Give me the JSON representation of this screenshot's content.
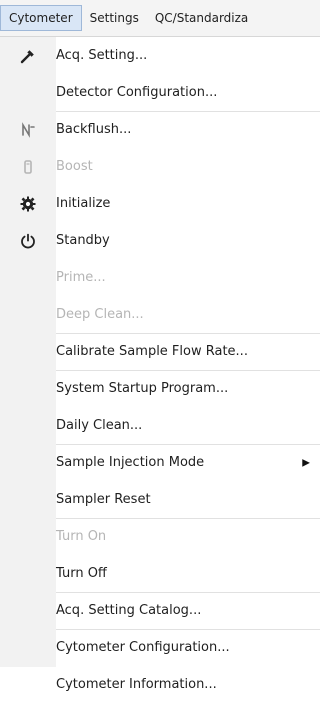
{
  "menubar": {
    "items": [
      {
        "label": "Cytometer"
      },
      {
        "label": "Settings"
      },
      {
        "label": "QC/Standardiza"
      }
    ]
  },
  "menu": {
    "items": [
      {
        "label": "Acq. Setting...",
        "icon": "wrench-icon",
        "disabled": false
      },
      {
        "label": "Detector Configuration...",
        "icon": "",
        "disabled": false
      },
      {
        "label": "Backflush...",
        "icon": "backflush-icon",
        "disabled": false
      },
      {
        "label": "Boost",
        "icon": "boost-icon",
        "disabled": true
      },
      {
        "label": "Initialize",
        "icon": "gear-icon",
        "disabled": false
      },
      {
        "label": "Standby",
        "icon": "power-icon",
        "disabled": false
      },
      {
        "label": "Prime...",
        "icon": "",
        "disabled": true
      },
      {
        "label": "Deep Clean...",
        "icon": "",
        "disabled": true
      },
      {
        "label": "Calibrate Sample Flow Rate...",
        "icon": "",
        "disabled": false
      },
      {
        "label": "System Startup Program...",
        "icon": "",
        "disabled": false
      },
      {
        "label": "Daily Clean...",
        "icon": "",
        "disabled": false
      },
      {
        "label": "Sample Injection Mode",
        "icon": "",
        "disabled": false,
        "submenu": true
      },
      {
        "label": "Sampler Reset",
        "icon": "",
        "disabled": false
      },
      {
        "label": "Turn On",
        "icon": "",
        "disabled": true
      },
      {
        "label": "Turn Off",
        "icon": "",
        "disabled": false
      },
      {
        "label": "Acq. Setting Catalog...",
        "icon": "",
        "disabled": false
      },
      {
        "label": "Cytometer Configuration...",
        "icon": "",
        "disabled": false
      },
      {
        "label": "Cytometer Information...",
        "icon": "",
        "disabled": false
      }
    ]
  }
}
